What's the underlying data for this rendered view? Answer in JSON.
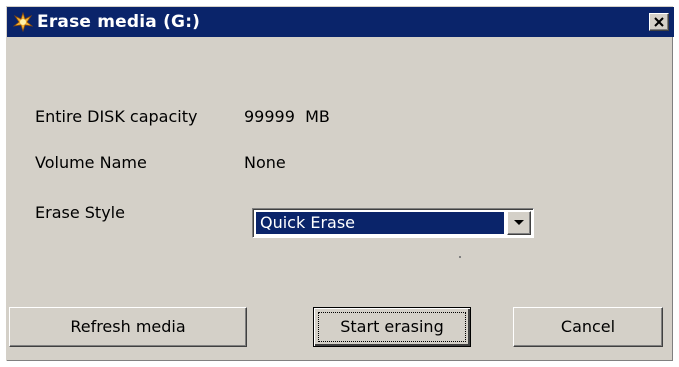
{
  "window": {
    "title": "Erase media (G:)",
    "close_symbol": "×",
    "icon": "app-icon",
    "title_bar_color": "#0a246a",
    "background_color": "#d4d0c8"
  },
  "fields": {
    "capacity_label": "Entire DISK capacity",
    "capacity_value": "99999  MB",
    "volume_label": "Volume Name",
    "volume_value": "None",
    "erase_style_label": "Erase Style",
    "erase_style_selected": "Quick Erase"
  },
  "buttons": {
    "refresh": "Refresh media",
    "start": "Start erasing",
    "cancel": "Cancel"
  }
}
